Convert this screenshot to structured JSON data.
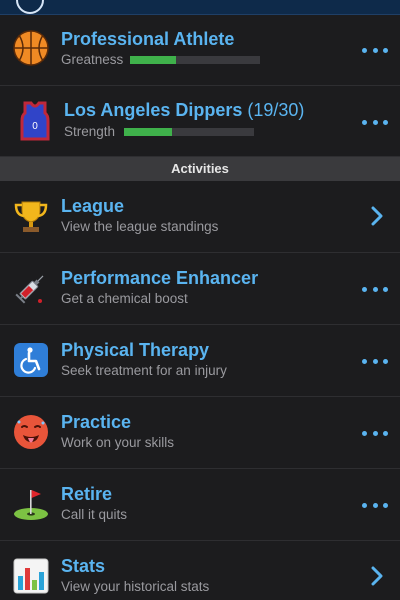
{
  "header": {
    "athlete": {
      "title": "Professional Athlete",
      "stat_label": "Greatness",
      "stat_fraction": 0.35
    },
    "team": {
      "title": "Los Angeles Dippers",
      "count": "(19/30)",
      "stat_label": "Strength",
      "stat_fraction": 0.37,
      "jersey_number": "0"
    }
  },
  "section_title": "Activities",
  "activities": [
    {
      "title": "League",
      "subtitle": "View the league standings",
      "icon": "trophy-icon",
      "action": "chevron"
    },
    {
      "title": "Performance Enhancer",
      "subtitle": "Get a chemical boost",
      "icon": "syringe-icon",
      "action": "more"
    },
    {
      "title": "Physical Therapy",
      "subtitle": "Seek treatment for an injury",
      "icon": "wheelchair-icon",
      "action": "more"
    },
    {
      "title": "Practice",
      "subtitle": "Work on your skills",
      "icon": "hot-face-icon",
      "action": "more"
    },
    {
      "title": "Retire",
      "subtitle": "Call it quits",
      "icon": "golf-flag-icon",
      "action": "more"
    },
    {
      "title": "Stats",
      "subtitle": "View your historical stats",
      "icon": "bar-chart-icon",
      "action": "chevron"
    }
  ],
  "colors": {
    "accent": "#5ab4f0",
    "progress": "#3fb14b",
    "background": "#1c1c1e"
  }
}
